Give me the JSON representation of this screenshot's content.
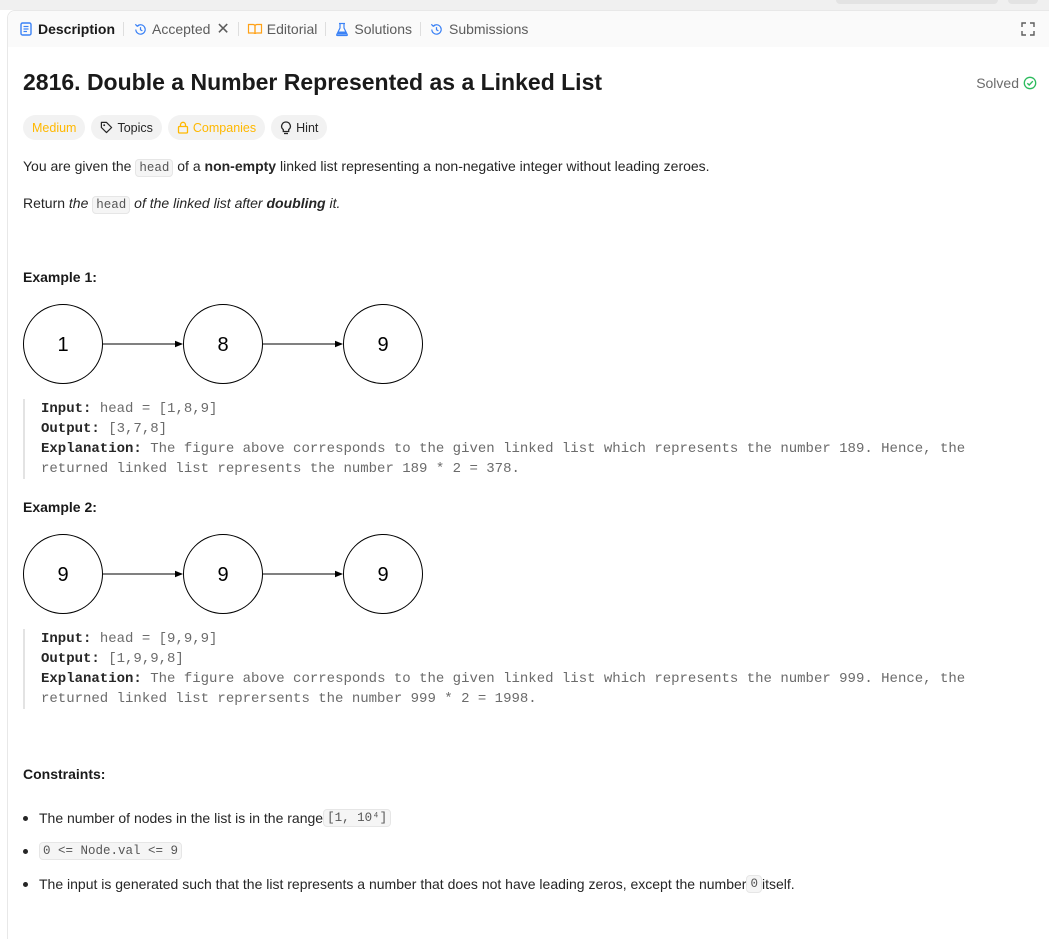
{
  "tabs": [
    {
      "label": "Description",
      "icon": "document-icon",
      "active": true
    },
    {
      "label": "Accepted",
      "icon": "history-icon",
      "closable": true
    },
    {
      "label": "Editorial",
      "icon": "book-icon"
    },
    {
      "label": "Solutions",
      "icon": "flask-icon"
    },
    {
      "label": "Submissions",
      "icon": "history-icon"
    }
  ],
  "tab_close_glyph": "✕",
  "problem": {
    "title": "2816. Double a Number Represented as a Linked List",
    "status": "Solved",
    "tags": [
      "Medium",
      "Topics",
      "Companies",
      "Hint"
    ],
    "desc1": {
      "a": "You are given the ",
      "code": "head",
      "b": " of a ",
      "strong": "non-empty",
      "c": " linked list representing a non-negative integer without leading zeroes."
    },
    "desc2": {
      "a": "Return ",
      "em1": "the ",
      "code": "head",
      "em2": " of the linked list after ",
      "strong": "doubling",
      "em3": " it."
    }
  },
  "examples": [
    {
      "heading": "Example 1:",
      "nodes": [
        "1",
        "8",
        "9"
      ],
      "input_label": "Input:",
      "input": "head = [1,8,9]",
      "output_label": "Output:",
      "output": "[3,7,8]",
      "explanation_label": "Explanation:",
      "explanation_1": "The figure above corresponds to the given linked list which represents the number 189. Hence, the",
      "explanation_2": "returned linked list represents the number 189 * 2 = 378."
    },
    {
      "heading": "Example 2:",
      "nodes": [
        "9",
        "9",
        "9"
      ],
      "input_label": "Input:",
      "input": "head = [9,9,9]",
      "output_label": "Output:",
      "output": "[1,9,9,8]",
      "explanation_label": "Explanation:",
      "explanation_1": "The figure above corresponds to the given linked list which represents the number 999. Hence, the",
      "explanation_2": "returned linked list reprersents the number 999 * 2 = 1998."
    }
  ],
  "constraints": {
    "heading": "Constraints:",
    "c1_text": "The number of nodes in the list is in the range ",
    "c1_code": "[1, 10⁴]",
    "c2_code": "0 <= Node.val <= 9",
    "c3_text": "The input is generated such that the list represents a number that does not have leading zeros, except the number ",
    "c3_code": "0",
    "c3_tail": " itself."
  },
  "colors": {
    "accent_blue": "#3b82f6",
    "medium": "#ffb800",
    "solved_green": "#2cbb5d"
  }
}
